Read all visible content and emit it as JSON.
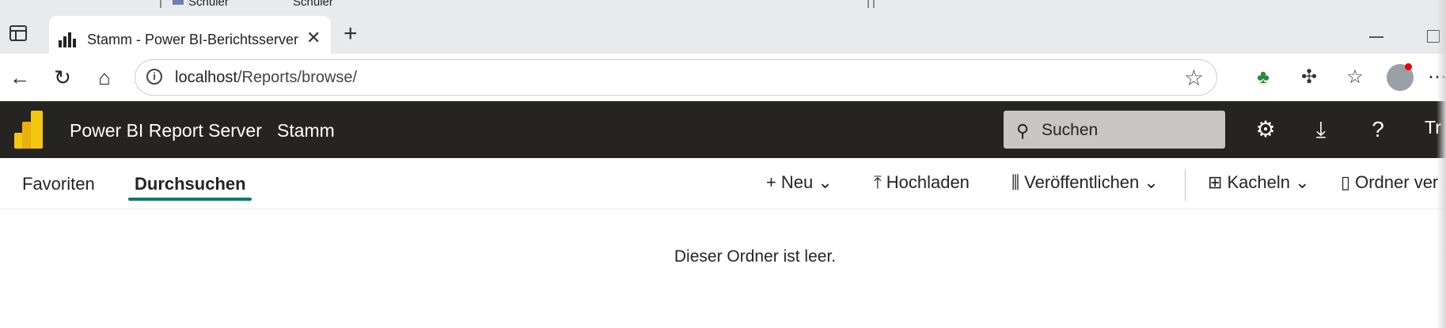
{
  "background_window": {
    "items": [
      "Schüler",
      "Schüler"
    ]
  },
  "browser": {
    "tab_title": "Stamm - Power BI-Berichtsserver",
    "url_host": "localhost",
    "url_path": "/Reports/browse/"
  },
  "header": {
    "app_name": "Power BI Report Server",
    "breadcrumb": "Stamm",
    "search_placeholder": "Suchen",
    "user_initials_partial": "Tr"
  },
  "nav": {
    "tabs": [
      {
        "label": "Favoriten",
        "active": false
      },
      {
        "label": "Durchsuchen",
        "active": true
      }
    ]
  },
  "commands": {
    "new": "Neu",
    "upload": "Hochladen",
    "publish": "Veröffentlichen",
    "view": "Kacheln",
    "folder": "Ordner ver"
  },
  "content": {
    "empty_message": "Dieser Ordner ist leer."
  },
  "colors": {
    "header_bg": "#252423",
    "accent_underline": "#117865",
    "logo_gold": "#F2C811"
  }
}
